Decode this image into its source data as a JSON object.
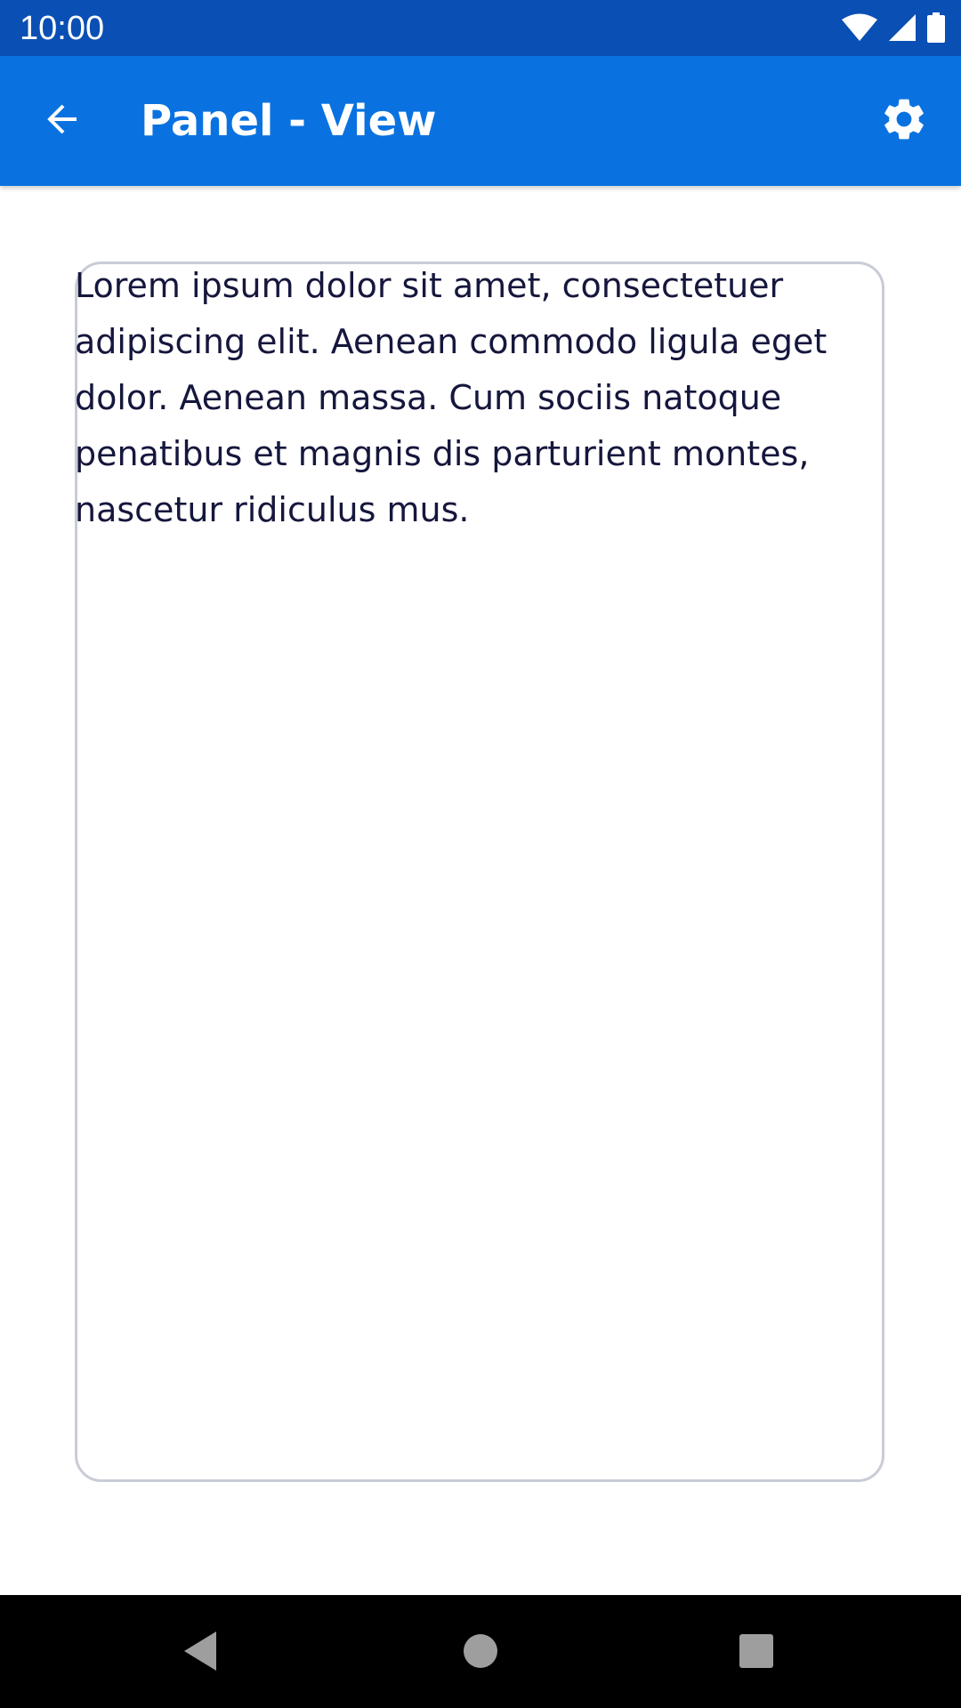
{
  "status_bar": {
    "time": "10:00",
    "icons": [
      "wifi-icon",
      "cellular-signal-icon",
      "battery-icon"
    ]
  },
  "app_bar": {
    "title": "Panel - View",
    "back_icon": "arrow-back-icon",
    "settings_icon": "gear-icon",
    "background_color": "#0a72e0"
  },
  "panel": {
    "text": "Lorem ipsum dolor sit amet, consectetuer adipiscing elit. Aenean commodo ligula eget dolor. Aenean massa. Cum sociis natoque penatibus et magnis dis parturient montes, nascetur ridiculus mus."
  },
  "nav_bar": {
    "icons": [
      "nav-back-triangle-icon",
      "nav-home-circle-icon",
      "nav-recents-square-icon"
    ]
  },
  "colors": {
    "status_bar": "#0a4fb3",
    "app_bar": "#0a72e0",
    "text": "#15173d",
    "panel_border": "#c9ccd6"
  }
}
